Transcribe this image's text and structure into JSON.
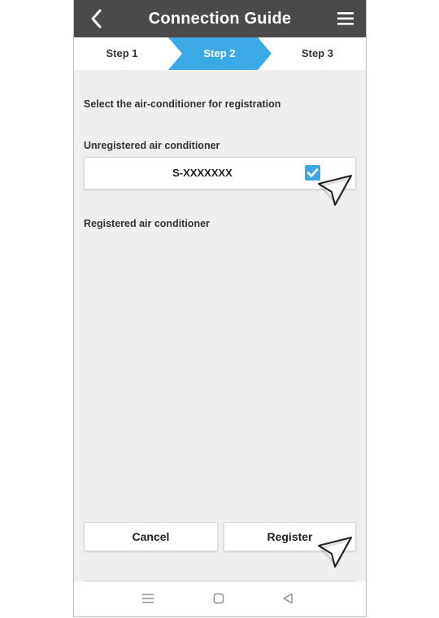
{
  "header": {
    "title": "Connection Guide",
    "back_icon": "chevron-left-icon",
    "menu_icon": "hamburger-menu-icon"
  },
  "steps": [
    {
      "label": "Step 1",
      "active": false
    },
    {
      "label": "Step 2",
      "active": true
    },
    {
      "label": "Step 3",
      "active": false
    }
  ],
  "main": {
    "instruction": "Select the air-conditioner for registration",
    "unregistered_label": "Unregistered air conditioner",
    "unregistered_units": [
      {
        "name": "S-XXXXXXX",
        "checked": true
      }
    ],
    "registered_label": "Registered air conditioner"
  },
  "buttons": {
    "cancel": "Cancel",
    "register": "Register"
  },
  "navbar": {
    "icons": [
      "recent-apps-icon",
      "home-icon",
      "back-triangle-icon"
    ]
  },
  "colors": {
    "header_bg": "#4a4a4a",
    "accent": "#3aa9e6",
    "background": "#efefef"
  }
}
